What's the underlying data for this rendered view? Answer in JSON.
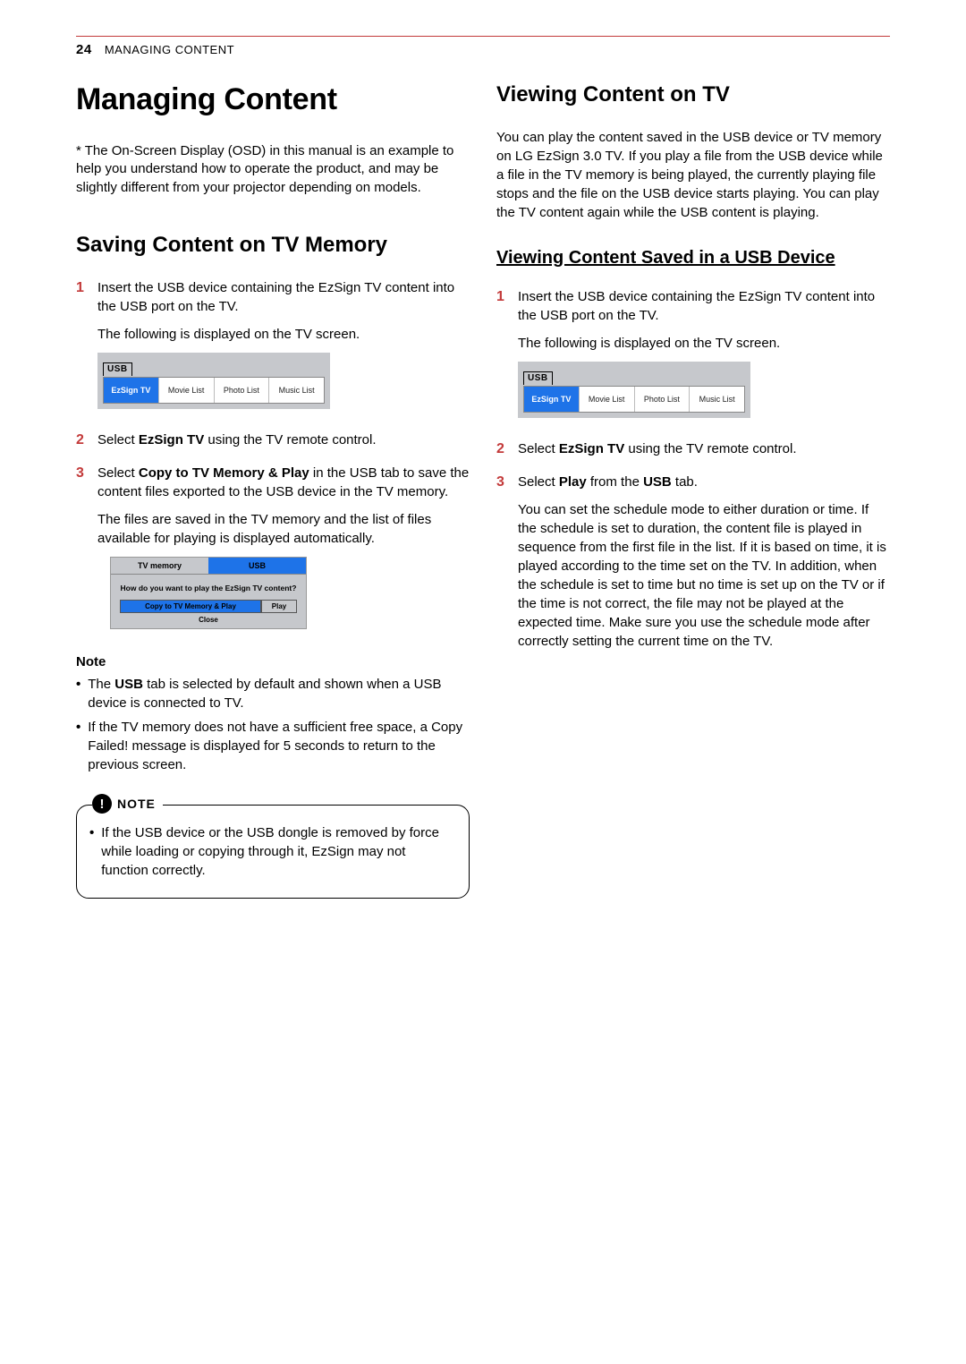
{
  "header": {
    "page_number": "24",
    "running_title": "MANAGING CONTENT"
  },
  "left": {
    "chapter_title": "Managing Content",
    "asterisk_note": "* The On-Screen Display (OSD) in this manual is an example to help you understand how to operate the product, and may be slightly different from your projector depending on models.",
    "section_title": "Saving Content on TV Memory",
    "steps": {
      "s1": {
        "num": "1",
        "p1": "Insert the USB device containing the EzSign TV content into the USB port on the TV.",
        "p2": "The following is displayed on the TV screen."
      },
      "s2": {
        "num": "2",
        "pre": "Select ",
        "bold": "EzSign TV",
        "post": " using the TV remote control."
      },
      "s3": {
        "num": "3",
        "pre": "Select ",
        "bold": "Copy to TV Memory & Play",
        "post": " in the USB tab to save the content files exported to the USB device in the TV memory.",
        "p2": "The files are saved in the TV memory and the list of files available for playing is displayed automatically."
      }
    },
    "usb_popup": {
      "label": "USB",
      "tabs": [
        "EzSign TV",
        "Movie List",
        "Photo List",
        "Music List"
      ]
    },
    "mem_popup": {
      "tab_left": "TV memory",
      "tab_right": "USB",
      "question": "How do you want to play the EzSign TV content?",
      "btn_copy": "Copy to TV Memory & Play",
      "btn_play": "Play",
      "btn_close": "Close"
    },
    "note_head": "Note",
    "note_bullets": {
      "b1_pre": "The ",
      "b1_bold": "USB",
      "b1_post": " tab is selected by default and shown when a USB device is connected to TV.",
      "b2": "If the TV memory does not have a sufficient free space, a Copy Failed! message is displayed for 5 seconds to return to the previous screen."
    },
    "note_box": {
      "badge": "NOTE",
      "text": "If the USB device or the USB dongle is removed by force while loading or copying through it, EzSign may not function correctly."
    }
  },
  "right": {
    "section_title": "Viewing Content on TV",
    "intro": "You can play the content saved in the USB device or TV memory on LG EzSign 3.0 TV. If you play a file from the USB device while a file in the TV memory is being played, the currently playing file stops and the file on the USB device starts playing. You can play the TV content again while the USB content is playing.",
    "subsection_title": "Viewing Content Saved in a USB Device",
    "steps": {
      "s1": {
        "num": "1",
        "p1": "Insert the USB device containing the EzSign TV content into the USB port on the TV.",
        "p2": "The following is displayed on the TV screen."
      },
      "s2": {
        "num": "2",
        "pre": "Select ",
        "bold": "EzSign TV",
        "post": " using the TV remote control."
      },
      "s3": {
        "num": "3",
        "pre": "Select ",
        "bold1": "Play",
        "mid": " from the  ",
        "bold2": "USB",
        "post": " tab.",
        "p2": "You can set the schedule mode to either duration or time. If the schedule is set to duration, the content file is played in sequence from the first file in the list. If it is based on time, it is played according to the time set on the TV. In addition, when the schedule is set to time but no time is set up on the TV or if the time is not correct, the file may not be played at the expected time. Make sure you use the schedule mode after correctly setting the current time on the TV."
      }
    },
    "usb_popup": {
      "label": "USB",
      "tabs": [
        "EzSign TV",
        "Movie List",
        "Photo List",
        "Music List"
      ]
    }
  }
}
